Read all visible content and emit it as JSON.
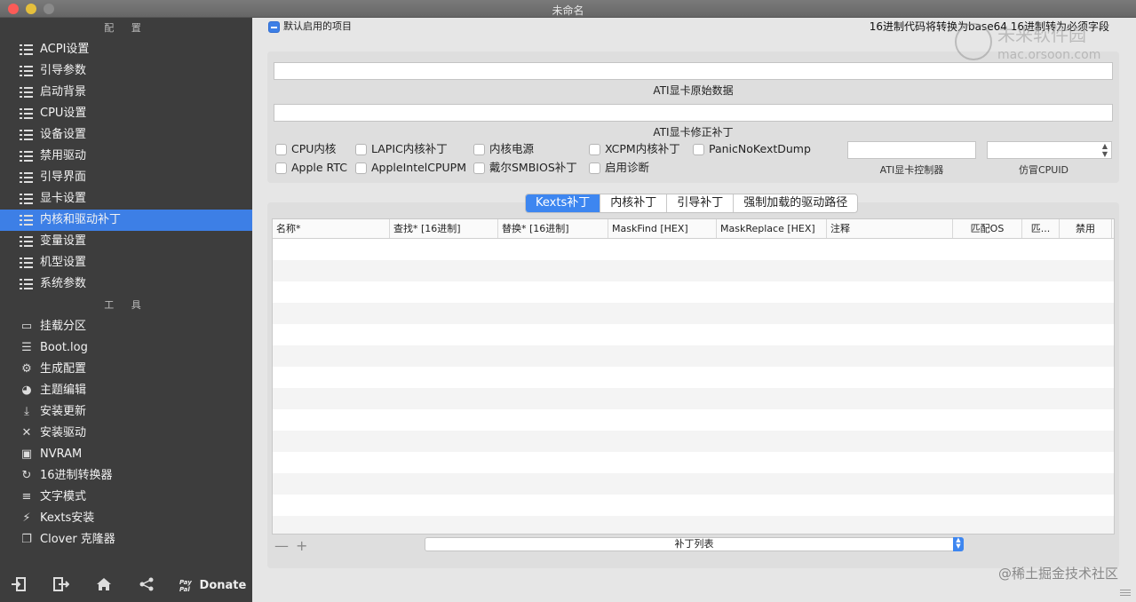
{
  "window": {
    "title": "未命名"
  },
  "sidebar": {
    "config_section": "配 置",
    "config_items": [
      {
        "label": "ACPI设置"
      },
      {
        "label": "引导参数"
      },
      {
        "label": "启动背景"
      },
      {
        "label": "CPU设置"
      },
      {
        "label": "设备设置"
      },
      {
        "label": "禁用驱动"
      },
      {
        "label": "引导界面"
      },
      {
        "label": "显卡设置"
      },
      {
        "label": "内核和驱动补丁",
        "active": true
      },
      {
        "label": "变量设置"
      },
      {
        "label": "机型设置"
      },
      {
        "label": "系统参数"
      }
    ],
    "tools_section": "工 具",
    "tool_items": [
      {
        "label": "挂载分区",
        "icon": "drive-icon"
      },
      {
        "label": "Boot.log",
        "icon": "log-icon"
      },
      {
        "label": "生成配置",
        "icon": "gears-icon"
      },
      {
        "label": "主题编辑",
        "icon": "palette-icon"
      },
      {
        "label": "安装更新",
        "icon": "download-icon"
      },
      {
        "label": "安装驱动",
        "icon": "wrench-icon"
      },
      {
        "label": "NVRAM",
        "icon": "chip-icon"
      },
      {
        "label": "16进制转换器",
        "icon": "refresh-icon"
      },
      {
        "label": "文字模式",
        "icon": "text-icon"
      },
      {
        "label": "Kexts安装",
        "icon": "plug-icon"
      },
      {
        "label": "Clover 克隆器",
        "icon": "copy-icon"
      }
    ],
    "footer": {
      "donate": "Donate",
      "paypal": "Pay Pal"
    }
  },
  "main": {
    "default_enabled_label": "默认启用的项目",
    "hex_note": "16进制代码将转换为base64 16进制转为必须字段",
    "ati_raw_label": "ATI显卡原始数据",
    "ati_patch_label": "ATI显卡修正补丁",
    "options_row1": [
      "CPU内核",
      "LAPIC内核补丁",
      "内核电源",
      "XCPM内核补丁",
      "PanicNoKextDump"
    ],
    "options_row2": [
      "Apple RTC",
      "AppleIntelCPUPM",
      "戴尔SMBIOS补丁",
      "启用诊断"
    ],
    "ati_controller_label": "ATI显卡控制器",
    "fake_cpuid_label": "仿冒CPUID",
    "tabs": [
      "Kexts补丁",
      "内核补丁",
      "引导补丁",
      "强制加载的驱动路径"
    ],
    "table_headers": [
      "名称*",
      "查找* [16进制]",
      "替换* [16进制]",
      "MaskFind [HEX]",
      "MaskReplace [HEX]",
      "注释",
      "匹配OS",
      "匹...",
      "禁用"
    ],
    "add_remove": {
      "minus": "—",
      "plus": "+"
    },
    "patch_list_label": "补丁列表"
  },
  "watermarks": {
    "top_right_line1": "未来软件园",
    "top_right_line2": "mac.orsoon.com",
    "bottom_right": "@稀土掘金技术社区"
  },
  "colors": {
    "sidebar_bg": "#3d3d3d",
    "accent": "#3d7fe6",
    "main_bg": "#e6e6e6"
  }
}
